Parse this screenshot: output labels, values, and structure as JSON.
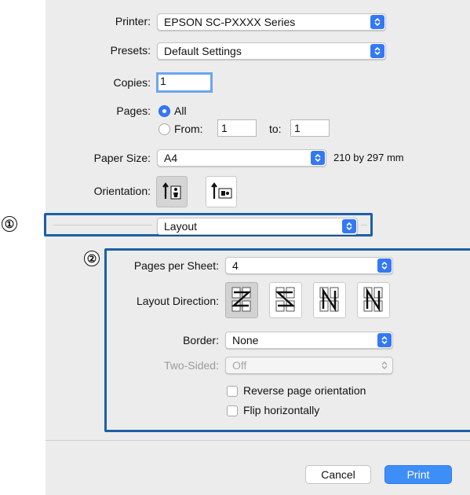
{
  "printer": {
    "label": "Printer:",
    "value": "EPSON SC-PXXXX Series"
  },
  "presets": {
    "label": "Presets:",
    "value": "Default Settings"
  },
  "copies": {
    "label": "Copies:",
    "value": "1"
  },
  "pages": {
    "label": "Pages:",
    "all_label": "All",
    "from_label": "From:",
    "from_value": "1",
    "to_label": "to:",
    "to_value": "1",
    "selected": "All"
  },
  "paper_size": {
    "label": "Paper Size:",
    "value": "A4",
    "dimensions": "210 by 297 mm"
  },
  "orientation": {
    "label": "Orientation:",
    "options": [
      "portrait-icon",
      "landscape-icon"
    ],
    "selected": "portrait"
  },
  "section_menu": {
    "value": "Layout"
  },
  "callouts": {
    "one": "①",
    "two": "②"
  },
  "layout": {
    "pages_per_sheet": {
      "label": "Pages per Sheet:",
      "value": "4"
    },
    "layout_direction": {
      "label": "Layout Direction:",
      "options": [
        "z-order-icon",
        "reverse-z-order-icon",
        "reverse-n-order-icon",
        "n-order-icon"
      ],
      "selected_index": 0
    },
    "border": {
      "label": "Border:",
      "value": "None"
    },
    "two_sided": {
      "label": "Two-Sided:",
      "value": "Off",
      "enabled": false
    },
    "reverse_orientation": {
      "label": "Reverse page orientation",
      "checked": false
    },
    "flip_horizontally": {
      "label": "Flip horizontally",
      "checked": false
    }
  },
  "buttons": {
    "cancel": "Cancel",
    "print": "Print"
  },
  "colors": {
    "accent": "#3478f6",
    "highlight_box": "#1d5fa6",
    "panel_bg": "#ececec"
  }
}
